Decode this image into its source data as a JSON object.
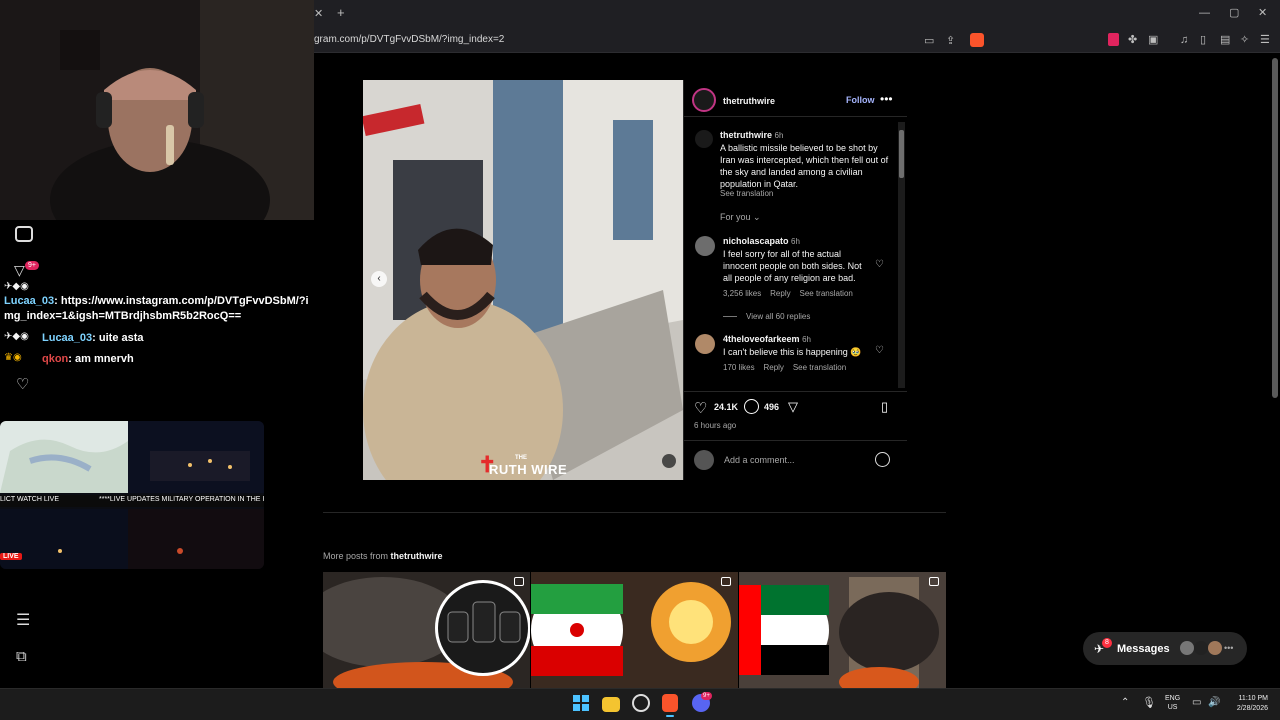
{
  "browser": {
    "url": "gram.com/p/DVTgFvvDSbM/?img_index=2",
    "new_tab": "+",
    "close_tab": "✕",
    "window_controls": [
      "minimize-icon",
      "maximize-icon",
      "close-icon"
    ]
  },
  "stream": {
    "chat": [
      {
        "user": "Lucaa_03",
        "text": "https://www.instagram.com/p/DVTgFvvDSbM/?img_index=1&igsh=MTBrdjhsbmR5b2RocQ=="
      },
      {
        "user": "Lucaa_03",
        "text": "uite asta"
      },
      {
        "user": "qkon",
        "text": "am mnervh"
      }
    ],
    "notification_badge": "9+",
    "thumb_labels": [
      "LICT WATCH LIVE",
      "****LIVE UPDATES MILITARY OPERATION IN THE I"
    ],
    "live_label": "LIVE"
  },
  "post": {
    "username": "thetruthwire",
    "follow_label": "Follow",
    "more_icon": "more-horizontal-icon",
    "watermark": {
      "small": "THE",
      "big": "RUTH WIRE"
    },
    "caption": {
      "user": "thetruthwire",
      "time": "6h",
      "text": "A ballistic missile believed to be shot by Iran was intercepted, which then fell out of the sky and landed among a civilian population in Qatar.",
      "see_translation": "See translation"
    },
    "for_you": "For you",
    "comments": [
      {
        "user": "nicholascapato",
        "time": "6h",
        "text": "I feel sorry for all of the actual innocent people on both sides. Not all people of any religion are bad.",
        "likes": "3,256 likes",
        "reply": "Reply",
        "translate": "See translation",
        "view_replies": "View all 60 replies"
      },
      {
        "user": "4theloveofarkeem",
        "time": "6h",
        "text": "I can't believe this is happening 🥹",
        "likes": "170 likes",
        "reply": "Reply",
        "translate": "See translation"
      }
    ],
    "like_count": "24.1K",
    "comment_count": "496",
    "posted": "6 hours ago",
    "comment_placeholder": "Add a comment..."
  },
  "more_posts": {
    "prefix": "More posts from",
    "user": "thetruthwire"
  },
  "messages": {
    "label": "Messages",
    "badge": "8"
  },
  "taskbar": {
    "lang": "ENG",
    "region": "US",
    "time": "11:10 PM",
    "date": "2/28/2026",
    "discord_badge": "9+"
  }
}
